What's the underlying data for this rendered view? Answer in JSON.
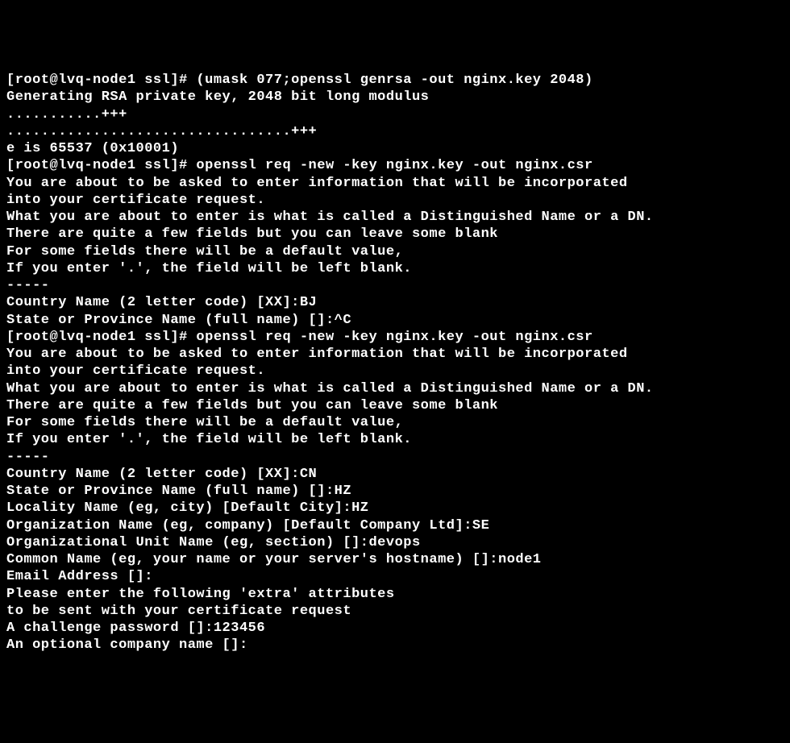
{
  "lines": [
    "[root@lvq-node1 ssl]# (umask 077;openssl genrsa -out nginx.key 2048)",
    "Generating RSA private key, 2048 bit long modulus",
    "...........+++",
    ".................................+++",
    "e is 65537 (0x10001)",
    "[root@lvq-node1 ssl]# openssl req -new -key nginx.key -out nginx.csr",
    "You are about to be asked to enter information that will be incorporated",
    "into your certificate request.",
    "What you are about to enter is what is called a Distinguished Name or a DN.",
    "There are quite a few fields but you can leave some blank",
    "For some fields there will be a default value,",
    "If you enter '.', the field will be left blank.",
    "-----",
    "Country Name (2 letter code) [XX]:BJ",
    "State or Province Name (full name) []:^C",
    "[root@lvq-node1 ssl]# openssl req -new -key nginx.key -out nginx.csr",
    "You are about to be asked to enter information that will be incorporated",
    "into your certificate request.",
    "What you are about to enter is what is called a Distinguished Name or a DN.",
    "There are quite a few fields but you can leave some blank",
    "For some fields there will be a default value,",
    "If you enter '.', the field will be left blank.",
    "-----",
    "Country Name (2 letter code) [XX]:CN",
    "State or Province Name (full name) []:HZ",
    "Locality Name (eg, city) [Default City]:HZ",
    "Organization Name (eg, company) [Default Company Ltd]:SE",
    "Organizational Unit Name (eg, section) []:devops",
    "Common Name (eg, your name or your server's hostname) []:node1",
    "Email Address []:",
    "",
    "Please enter the following 'extra' attributes",
    "to be sent with your certificate request",
    "A challenge password []:123456",
    "An optional company name []:"
  ]
}
